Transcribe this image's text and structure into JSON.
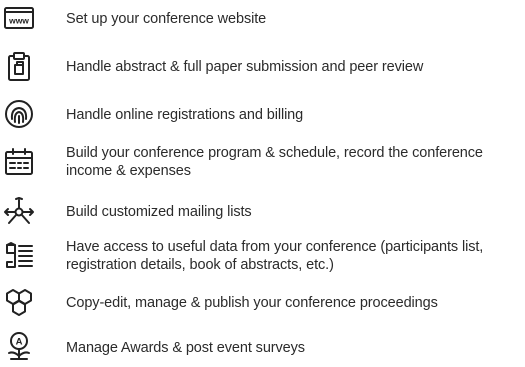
{
  "features": [
    {
      "icon": "www-icon",
      "text": "Set up your conference website"
    },
    {
      "icon": "clipboard-icon",
      "text": "Handle abstract & full paper submission and peer review"
    },
    {
      "icon": "fingerprint-icon",
      "text": "Handle online registrations and billing"
    },
    {
      "icon": "calendar-icon",
      "text": "Build your conference program & schedule, record the conference income & expenses"
    },
    {
      "icon": "network-icon",
      "text": "Build customized mailing lists"
    },
    {
      "icon": "data-list-icon",
      "text": "Have access to useful data from your conference (participants list, registration details, book of abstracts, etc.)"
    },
    {
      "icon": "hexagons-icon",
      "text": "Copy-edit, manage & publish your conference proceedings"
    },
    {
      "icon": "award-icon",
      "text": "Manage Awards & post event surveys"
    }
  ]
}
